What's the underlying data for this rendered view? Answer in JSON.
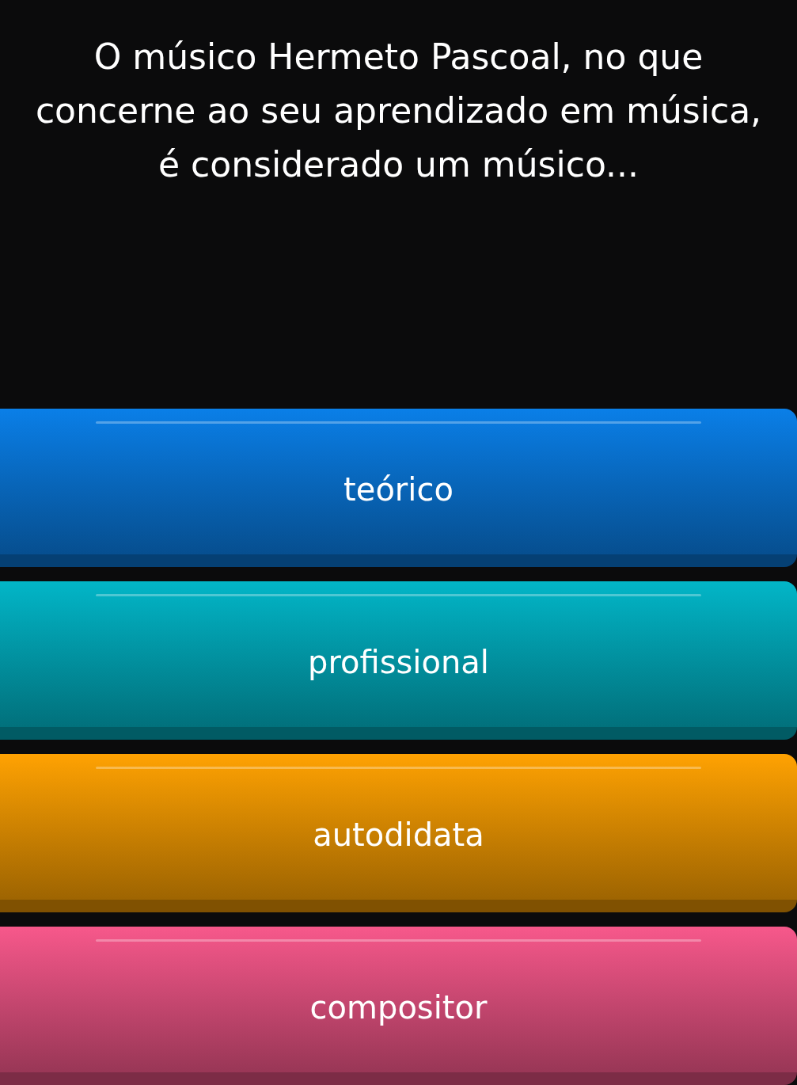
{
  "question": "O músico Hermeto Pascoal, no que concerne ao seu aprendizado em música, é considerado um músico...",
  "answers": [
    {
      "label": "teórico",
      "color": "#0a7fe8"
    },
    {
      "label": "profissional",
      "color": "#02b6c8"
    },
    {
      "label": "autodidata",
      "color": "#ffa202"
    },
    {
      "label": "compositor",
      "color": "#f7588b"
    }
  ]
}
